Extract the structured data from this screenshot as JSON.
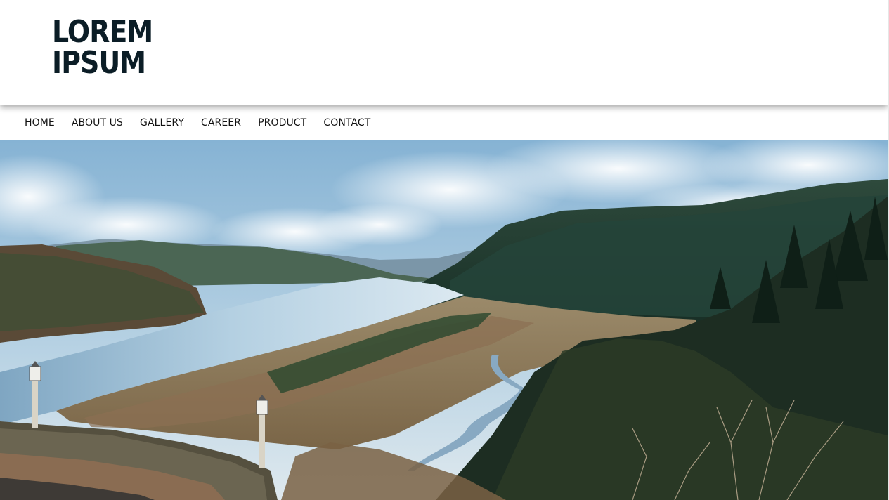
{
  "logo": {
    "line1": "LOREM",
    "line2": "IPSUM"
  },
  "nav": {
    "items": [
      {
        "label": "HOME"
      },
      {
        "label": "ABOUT US"
      },
      {
        "label": "GALLERY"
      },
      {
        "label": "CAREER"
      },
      {
        "label": "PRODUCT"
      },
      {
        "label": "CONTACT"
      }
    ]
  },
  "colors": {
    "logo": "#0b1d26",
    "nav_text": "#111111",
    "sky": "#9fc3dc",
    "river": "#9bbfd6",
    "forest": "#1f3a30"
  }
}
